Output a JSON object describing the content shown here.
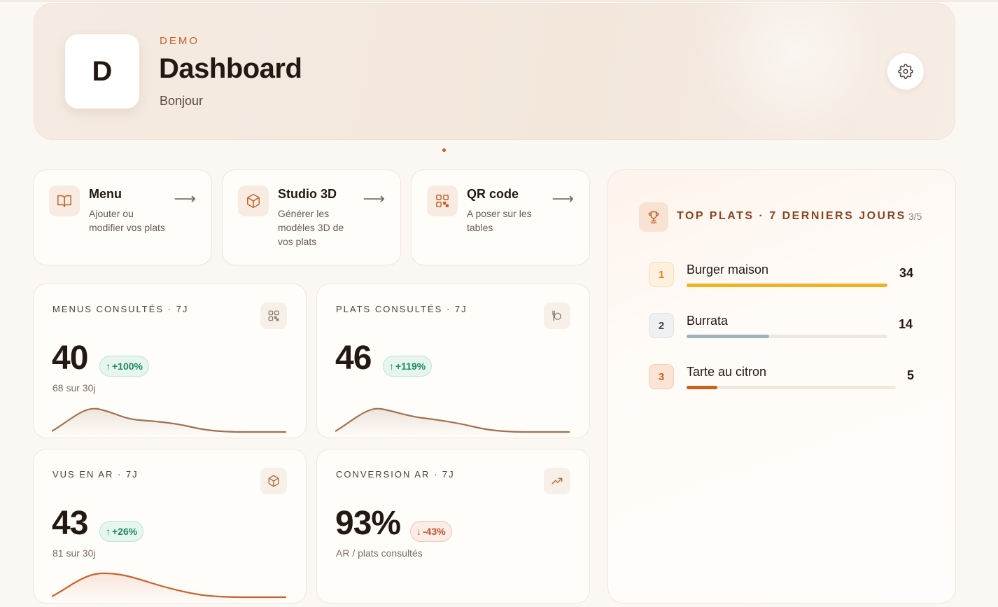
{
  "header": {
    "avatar_letter": "D",
    "eyebrow": "DEMO",
    "title": "Dashboard",
    "subtitle": "Bonjour"
  },
  "shortcuts": [
    {
      "title": "Menu",
      "description": "Ajouter ou modifier vos plats",
      "icon": "book-icon"
    },
    {
      "title": "Studio 3D",
      "description": "Générer les modèles 3D de vos plats",
      "icon": "cube-icon"
    },
    {
      "title": "QR code",
      "description": "A poser sur les tables",
      "icon": "qr-icon"
    }
  ],
  "stats": [
    {
      "label": "MENUS CONSULTÉS · 7J",
      "value": "40",
      "change": "+100%",
      "trend": "up",
      "sub": "68 sur 30j",
      "icon": "qr-icon"
    },
    {
      "label": "PLATS CONSULTÉS · 7J",
      "value": "46",
      "change": "+119%",
      "trend": "up",
      "sub": "",
      "icon": "plate-icon"
    },
    {
      "label": "VUS EN AR · 7J",
      "value": "43",
      "change": "+26%",
      "trend": "up",
      "sub": "81 sur 30j",
      "icon": "cube-icon"
    },
    {
      "label": "CONVERSION AR · 7J",
      "value": "93%",
      "change": "-43%",
      "trend": "down",
      "sub": "AR / plats consultés",
      "icon": "trending-up-icon"
    }
  ],
  "top_dishes": {
    "title": "TOP PLATS · 7 DERNIERS JOURS",
    "count": "3/5",
    "items": [
      {
        "rank": "1",
        "name": "Burger maison",
        "value": "34",
        "share": 1.0,
        "color": "#f0b224"
      },
      {
        "rank": "2",
        "name": "Burrata",
        "value": "14",
        "share": 0.41,
        "color": "#9fb3bd"
      },
      {
        "rank": "3",
        "name": "Tarte au citron",
        "value": "5",
        "share": 0.147,
        "color": "#c9621f"
      }
    ]
  },
  "colors": {
    "accent": "#c0622a",
    "positive": "#1f8a5b",
    "negative": "#c0532a",
    "spark_brown": "#a07250",
    "spark_orange": "#c9622d"
  }
}
